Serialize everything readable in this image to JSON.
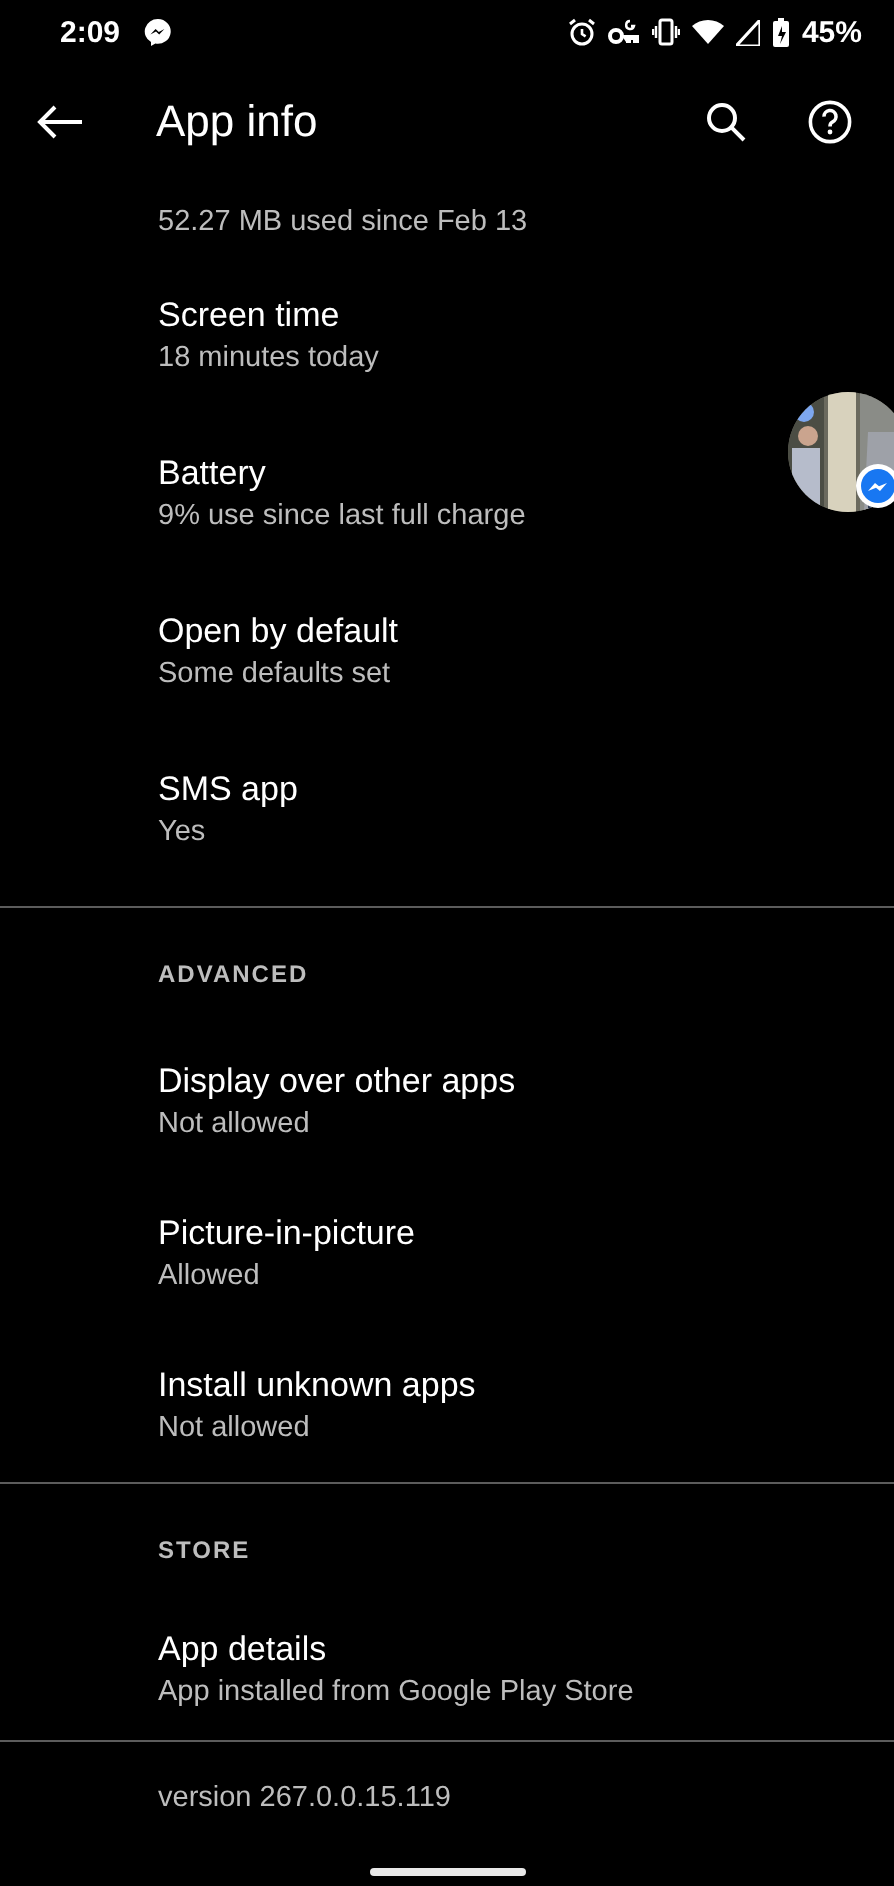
{
  "status_bar": {
    "time": "2:09",
    "battery_percent": "45%"
  },
  "app_bar": {
    "title": "App info"
  },
  "sections": [
    {
      "items": [
        {
          "subtitle": "52.27 MB used since Feb 13",
          "kind": "partial"
        },
        {
          "title": "Screen time",
          "subtitle": "18 minutes today"
        },
        {
          "title": "Battery",
          "subtitle": "9% use since last full charge"
        },
        {
          "title": "Open by default",
          "subtitle": "Some defaults set"
        },
        {
          "title": "SMS app",
          "subtitle": "Yes"
        }
      ]
    },
    {
      "header": "ADVANCED",
      "items": [
        {
          "title": "Display over other apps",
          "subtitle": "Not allowed"
        },
        {
          "title": "Picture-in-picture",
          "subtitle": "Allowed"
        },
        {
          "title": "Install unknown apps",
          "subtitle": "Not allowed"
        }
      ]
    },
    {
      "header": "STORE",
      "items": [
        {
          "title": "App details",
          "subtitle": "App installed from Google Play Store"
        }
      ]
    }
  ],
  "version": "version 267.0.0.15.119"
}
